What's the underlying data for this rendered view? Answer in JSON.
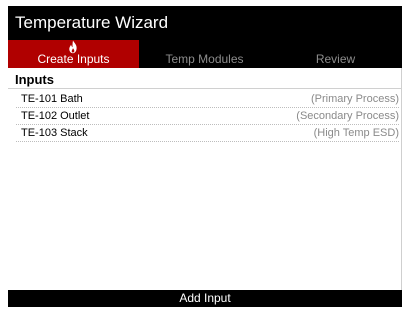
{
  "app": {
    "title": "Temperature Wizard"
  },
  "tabs": [
    {
      "label": "Create Inputs",
      "active": true
    },
    {
      "label": "Temp Modules",
      "active": false
    },
    {
      "label": "Review",
      "active": false
    }
  ],
  "section": {
    "title": "Inputs"
  },
  "inputs": [
    {
      "name": "TE-101 Bath",
      "description": "(Primary Process)"
    },
    {
      "name": "TE-102 Outlet",
      "description": "(Secondary Process)"
    },
    {
      "name": "TE-103 Stack",
      "description": "(High Temp ESD)"
    }
  ],
  "footer": {
    "add_label": "Add Input"
  },
  "colors": {
    "accent": "#b00000",
    "bar": "#000000",
    "muted": "#8a8a8a"
  },
  "icons": {
    "active_tab": "flame-icon"
  }
}
